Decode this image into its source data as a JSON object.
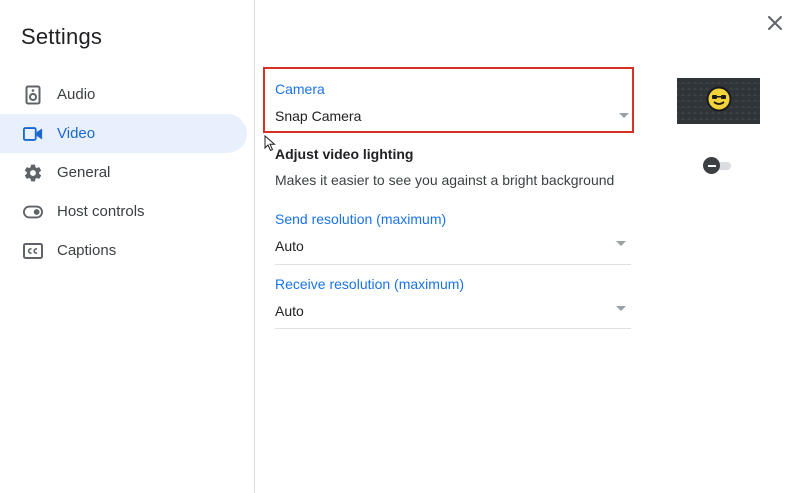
{
  "dialog": {
    "title": "Settings",
    "close_icon": "close-icon"
  },
  "sidebar": {
    "items": [
      {
        "label": "Audio",
        "icon": "speaker-icon",
        "active": false
      },
      {
        "label": "Video",
        "icon": "video-camera-icon",
        "active": true
      },
      {
        "label": "General",
        "icon": "gear-icon",
        "active": false
      },
      {
        "label": "Host controls",
        "icon": "toggle-switch-icon",
        "active": false
      },
      {
        "label": "Captions",
        "icon": "closed-captions-icon",
        "active": false
      }
    ]
  },
  "video": {
    "camera": {
      "label": "Camera",
      "value": "Snap Camera"
    },
    "lighting": {
      "title": "Adjust video lighting",
      "description": "Makes it easier to see you against a bright background",
      "enabled": false
    },
    "send_resolution": {
      "label": "Send resolution (maximum)",
      "value": "Auto"
    },
    "receive_resolution": {
      "label": "Receive resolution (maximum)",
      "value": "Auto"
    }
  },
  "colors": {
    "accent": "#1a73e8",
    "active_nav_bg": "#e8f0fe",
    "highlight_border": "#d93025"
  }
}
